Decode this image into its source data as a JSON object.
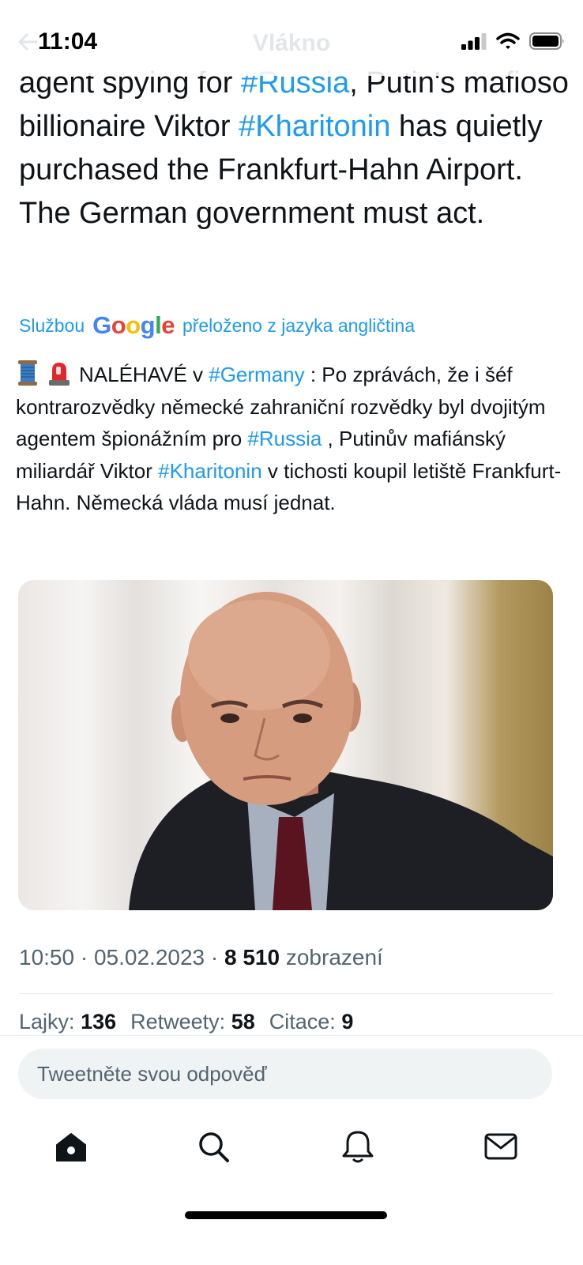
{
  "status_bar": {
    "time": "11:04"
  },
  "nav": {
    "title": "Vlákno"
  },
  "tweet": {
    "original_text": {
      "p1": "agent spying for ",
      "tag_russia": "#Russia",
      "p2": ", Putin's mafioso billionaire Viktor ",
      "tag_kharitonin": "#Kharitonin",
      "p3": " has quietly purchased the Frankfurt-Hahn Airport. The German government must act."
    },
    "translation_label": {
      "prefix": "Službou",
      "brand": "Google",
      "suffix": "přeloženo z jazyka angličtina"
    },
    "translated_text": {
      "p1": "NALÉHAVÉ v ",
      "tag_germany": "#Germany",
      "p2": " : Po zprávách, že i šéf kontrarozvědky německé zahraniční rozvědky byl dvojitým agentem špionážním pro ",
      "tag_russia": "#Russia",
      "p3": " , Putinův mafiánský miliardář Viktor ",
      "tag_kharitonin": "#Kharitonin",
      "p4": " v tichosti koupil letiště Frankfurt-Hahn. Německá vláda musí jednat."
    },
    "emojis": [
      "thread-spool",
      "police-light"
    ],
    "meta": {
      "time": "10:50",
      "date": "05.02.2023",
      "views_count": "8 510",
      "views_label": "zobrazení"
    },
    "stats": {
      "likes_label": "Lajky:",
      "likes": "136",
      "retweets_label": "Retweety:",
      "retweets": "58",
      "quotes_label": "Citace:",
      "quotes": "9"
    }
  },
  "reply": {
    "placeholder": "Tweetněte svou odpověď"
  },
  "tabbar": {
    "icons": [
      "home-icon",
      "search-icon",
      "bell-icon",
      "mail-icon"
    ]
  },
  "colors": {
    "link": "#1d9bf0",
    "text": "#0f1419",
    "secondary": "#536471"
  }
}
